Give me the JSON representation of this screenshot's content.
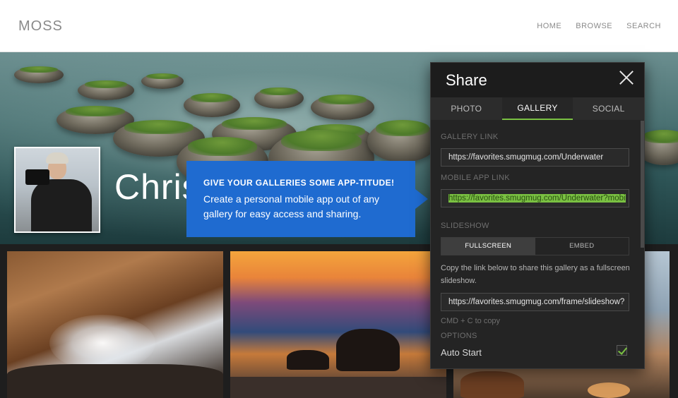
{
  "header": {
    "logo": "MOSS",
    "nav": [
      "HOME",
      "BROWSE",
      "SEARCH"
    ]
  },
  "hero": {
    "name": "Chris"
  },
  "tooltip": {
    "title": "GIVE YOUR GALLERIES SOME APP-TITUDE!",
    "text": "Create a personal mobile app out of any gallery for easy access and sharing."
  },
  "share": {
    "title": "Share",
    "tabs": [
      {
        "label": "PHOTO",
        "active": false
      },
      {
        "label": "GALLERY",
        "active": true
      },
      {
        "label": "SOCIAL",
        "active": false
      }
    ],
    "gallery_link_label": "GALLERY LINK",
    "gallery_link": "https://favorites.smugmug.com/Underwater",
    "mobile_app_link_label": "MOBILE APP LINK",
    "mobile_app_link": "https://favorites.smugmug.com/Underwater?mobi",
    "slideshow_label": "SLIDESHOW",
    "slideshow_modes": [
      "FULLSCREEN",
      "EMBED"
    ],
    "slideshow_selected": "FULLSCREEN",
    "slideshow_desc": "Copy the link below to share this gallery as a fullscreen slideshow.",
    "slideshow_link": "https://favorites.smugmug.com/frame/slideshow?",
    "copy_hint": "CMD + C to copy",
    "options_label": "OPTIONS",
    "auto_start_label": "Auto Start",
    "auto_start_checked": true
  },
  "colors": {
    "accent_green": "#7ac142",
    "tooltip_blue": "#1f6bd0",
    "panel_bg": "#242424"
  }
}
